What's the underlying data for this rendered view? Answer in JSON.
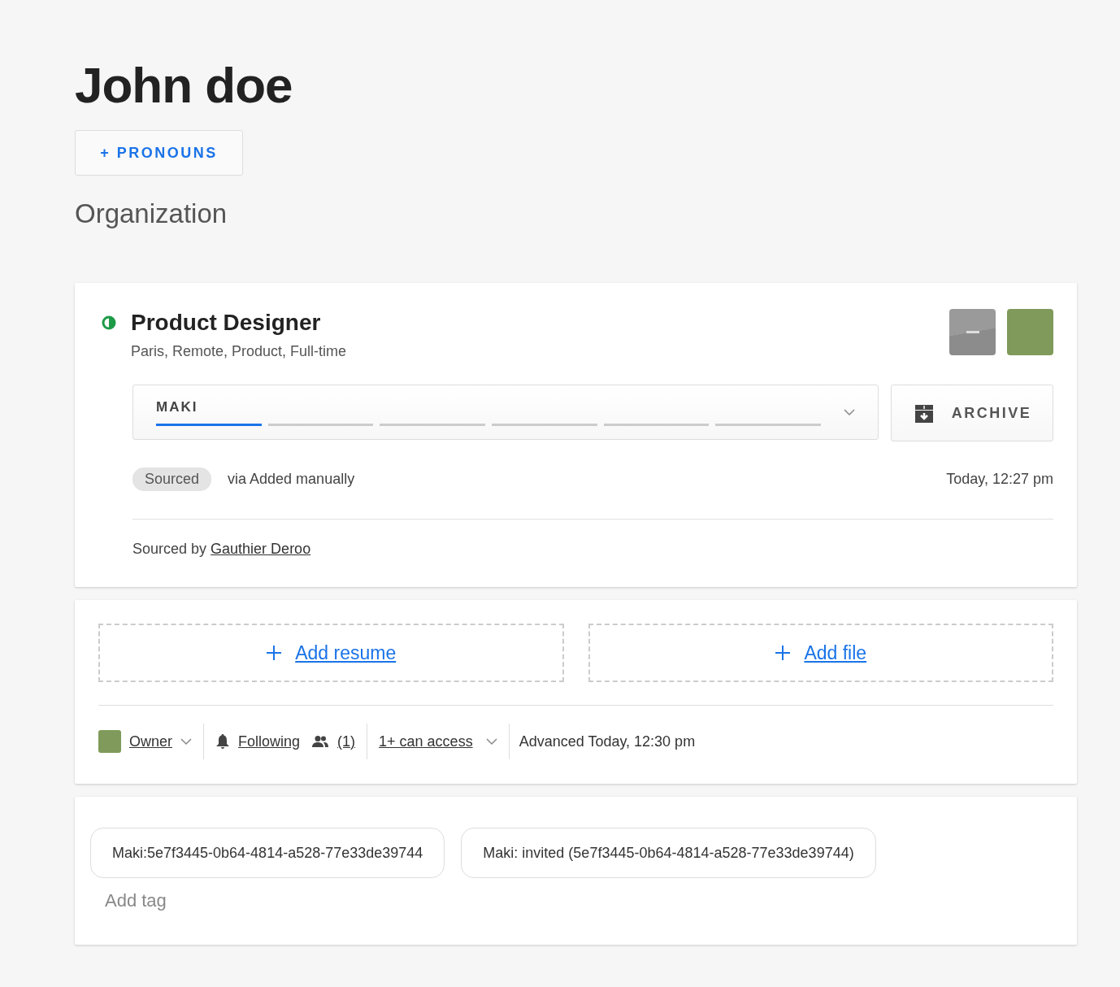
{
  "profile": {
    "name": "John doe",
    "pronouns_button": "+ PRONOUNS",
    "organization": "Organization"
  },
  "opportunity": {
    "title": "Product Designer",
    "details": "Paris, Remote, Product, Full-time",
    "stage": {
      "label": "MAKI",
      "segments": [
        {
          "selected": true
        },
        {
          "selected": false
        },
        {
          "selected": false
        },
        {
          "selected": false
        },
        {
          "selected": false
        },
        {
          "selected": false
        }
      ]
    },
    "archive_button": "ARCHIVE",
    "origin_tag": "Sourced",
    "origin": "via Added manually",
    "timestamp": "Today, 12:27 pm",
    "sourced_by_label": "Sourced by",
    "sourced_by": "Gauthier Deroo"
  },
  "files": {
    "add_resume": "Add resume",
    "add_file": "Add file"
  },
  "meta": {
    "owner": "Owner",
    "following": "Following",
    "followers": "(1)",
    "access": "1+ can access",
    "advanced": "Advanced Today, 12:30 pm"
  },
  "tags": {
    "items": [
      "Maki:5e7f3445-0b64-4814-a528-77e33de39744",
      "Maki: invited (5e7f3445-0b64-4814-a528-77e33de39744)"
    ],
    "placeholder": "Add tag"
  }
}
